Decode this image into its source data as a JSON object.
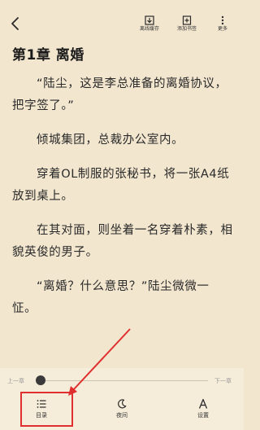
{
  "topbar": {
    "offline_cache": "离线缓存",
    "add_bookmark": "添加书签",
    "more": "更多"
  },
  "chapter": {
    "title": "第1章  离婚",
    "paragraphs": [
      "“陆尘，这是李总准备的离婚协议，把字签了。”",
      "倾城集团，总裁办公室内。",
      "穿着OL制服的张秘书，将一张A4纸放到桌上。",
      "在其对面，则坐着一名穿着朴素，相貌英俊的男子。",
      "“离婚？什么意思？”陆尘微微一怔。"
    ]
  },
  "progress": {
    "prev_chapter": "上一章",
    "next_chapter": "下一章",
    "value": 0
  },
  "bottom_nav": {
    "catalog": "目录",
    "night": "夜间",
    "settings": "设置"
  },
  "colors": {
    "background": "#f2e6cf",
    "text": "#262626",
    "highlight": "#e02f2f"
  }
}
